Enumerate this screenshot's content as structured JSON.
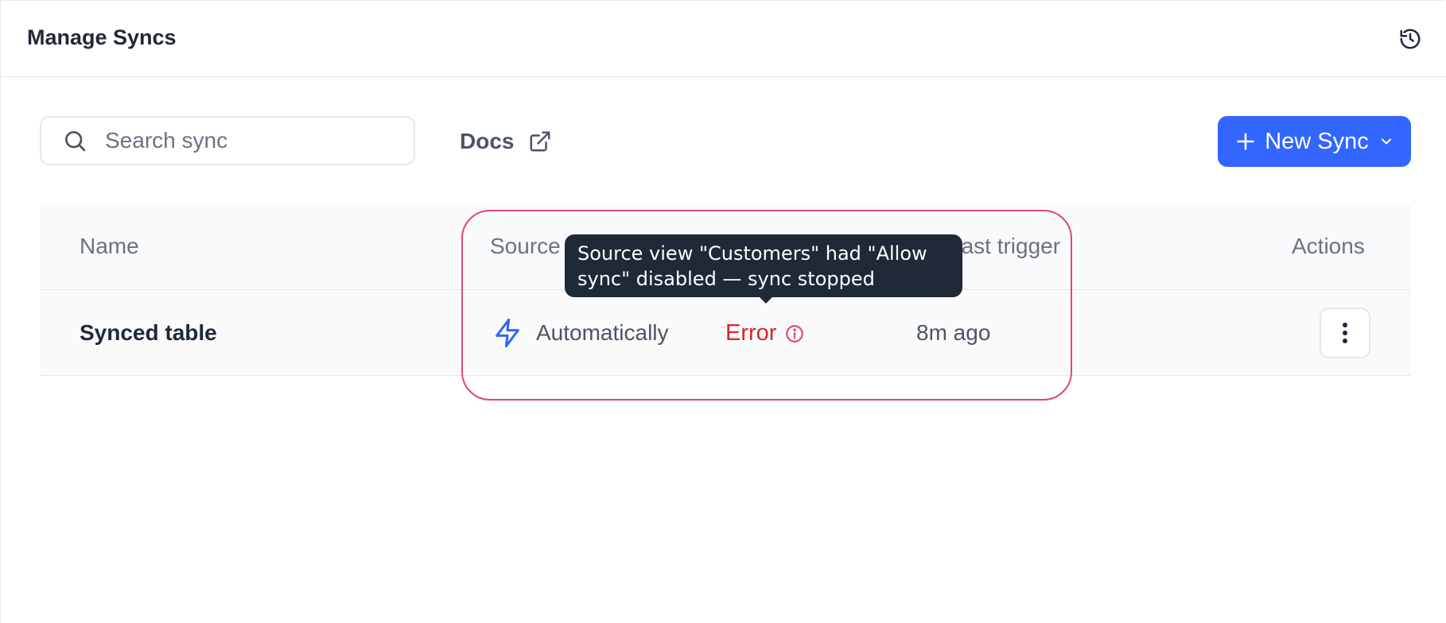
{
  "header": {
    "title": "Manage Syncs",
    "history_icon": "history-icon"
  },
  "toolbar": {
    "search_placeholder": "Search sync",
    "search_value": "",
    "docs_label": "Docs",
    "new_sync_label": "New Sync"
  },
  "table": {
    "columns": [
      "Name",
      "Source",
      "Last trigger",
      "Actions"
    ],
    "rows": [
      {
        "name": "Synced table",
        "source": "Automatically",
        "status": "Error",
        "last_trigger": "8m ago"
      }
    ]
  },
  "tooltip": {
    "text": "Source view \"Customers\" had \"Allow sync\" disabled — sync stopped"
  },
  "colors": {
    "primary": "#3366ff",
    "error": "#dc2626",
    "highlight": "#e0457b",
    "tooltip_bg": "#1f2937"
  }
}
